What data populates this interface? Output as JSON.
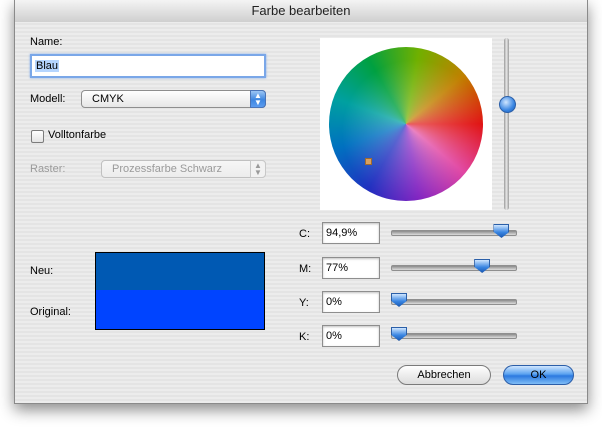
{
  "window": {
    "title": "Farbe bearbeiten"
  },
  "form": {
    "name_label": "Name:",
    "name_value": "Blau",
    "model_label": "Modell:",
    "model_value": "CMYK",
    "spot_color_label": "Volltonfarbe",
    "spot_color_checked": false,
    "screen_label": "Raster:",
    "screen_value": "Prozessfarbe Schwarz"
  },
  "preview": {
    "new_label": "Neu:",
    "original_label": "Original:",
    "new_color": "#0059b3",
    "original_color": "#0044ff"
  },
  "sliders": [
    {
      "label": "C:",
      "value": "94,9%",
      "fraction": 0.949
    },
    {
      "label": "M:",
      "value": "77%",
      "fraction": 0.77
    },
    {
      "label": "Y:",
      "value": "0%",
      "fraction": 0.0
    },
    {
      "label": "K:",
      "value": "0%",
      "fraction": 0.0
    }
  ],
  "buttons": {
    "cancel": "Abbrechen",
    "ok": "OK"
  },
  "colors": {
    "accent": "#3a86e2",
    "window_bg": "#ececec"
  }
}
